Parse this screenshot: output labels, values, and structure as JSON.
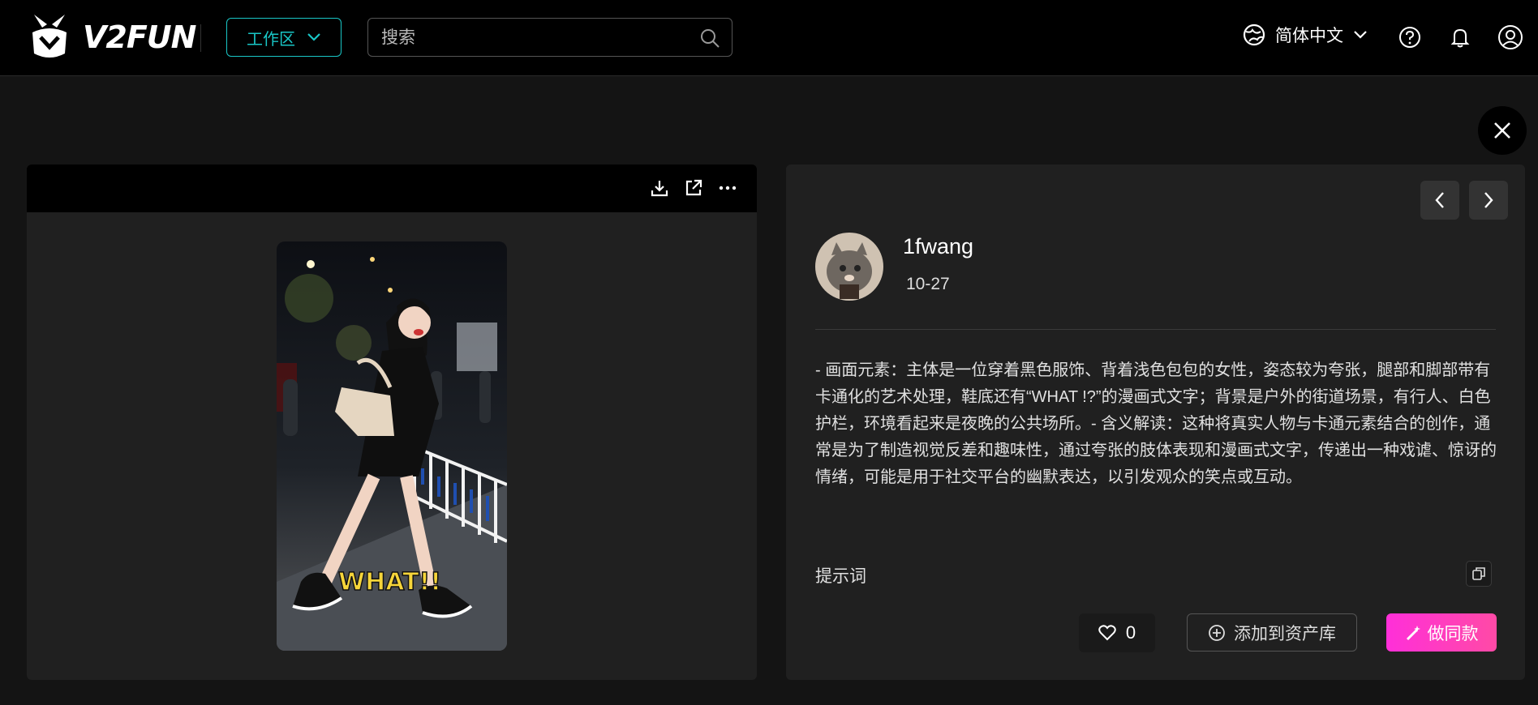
{
  "header": {
    "logo_text": "V2FUN",
    "workspace_label": "工作区",
    "search_placeholder": "搜索",
    "language_label": "简体中文"
  },
  "detail": {
    "username": "1fwang",
    "date": "10-27",
    "description": "- 画面元素：主体是一位穿着黑色服饰、背着浅色包包的女性，姿态较为夸张，腿部和脚部带有卡通化的艺术处理，鞋底还有“WHAT !?”的漫画式文字；背景是户外的街道场景，有行人、白色护栏，环境看起来是夜晚的公共场所。- 含义解读：这种将真实人物与卡通元素结合的创作，通常是为了制造视觉反差和趣味性，通过夸张的肢体表现和漫画式文字，传递出一种戏谑、惊讶的情绪，可能是用于社交平台的幽默表达，以引发观众的笑点或互动。",
    "prompt_label": "提示词",
    "like_count": "0",
    "add_asset_label": "添加到资产库",
    "make_same_label": "做同款"
  },
  "image_overlay_text": "WHAT!!",
  "colors": {
    "accent_teal": "#19c6c6",
    "accent_pink": "#ff2fd9",
    "background": "#141414",
    "panel": "#202020"
  },
  "icons": {
    "header": [
      "logo-icon",
      "chevron-down-icon",
      "search-icon",
      "globe-icon",
      "help-icon",
      "bell-icon",
      "user-icon"
    ],
    "toolbar": [
      "download-icon",
      "open-external-icon",
      "more-icon"
    ],
    "detail": [
      "chevron-left-icon",
      "chevron-right-icon",
      "close-icon",
      "copy-icon",
      "heart-icon",
      "plus-circle-icon",
      "magic-wand-icon"
    ]
  }
}
